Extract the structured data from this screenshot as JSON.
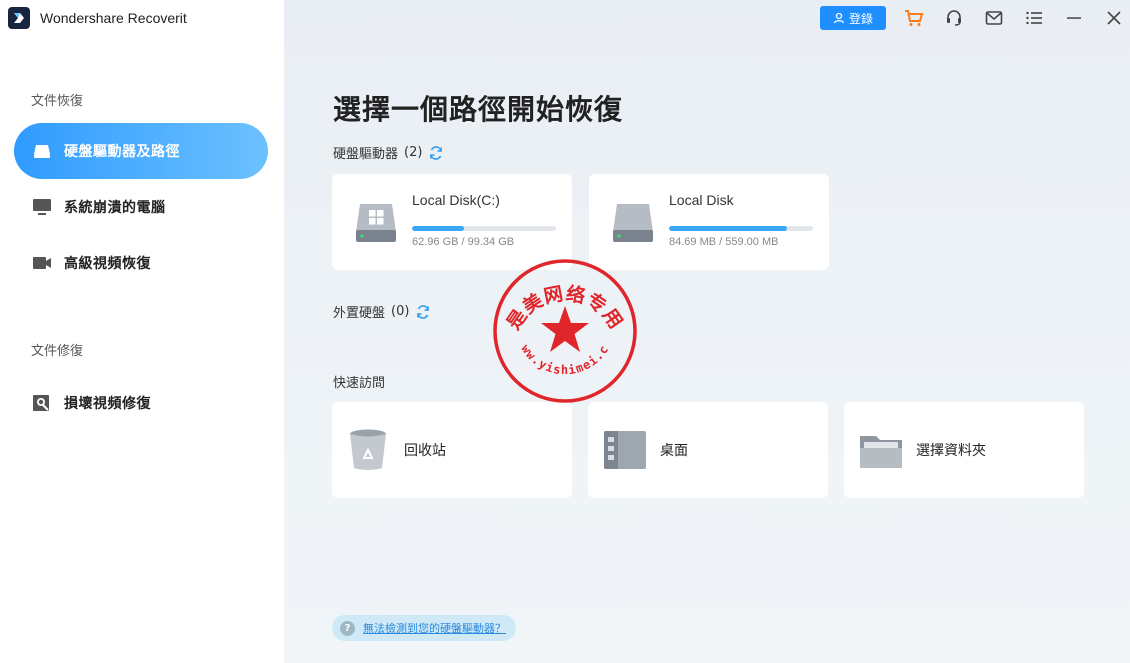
{
  "app": {
    "title": "Wondershare Recoverit"
  },
  "topbar": {
    "login_label": "登錄"
  },
  "sidebar": {
    "section_recover": "文件恢復",
    "items": [
      {
        "label": "硬盤驅動器及路徑",
        "icon": "hard-drive-icon",
        "active": true
      },
      {
        "label": "系統崩潰的電腦",
        "icon": "monitor-icon",
        "active": false
      },
      {
        "label": "高級視頻恢復",
        "icon": "video-camera-icon",
        "active": false
      }
    ],
    "section_repair": "文件修復",
    "repair_items": [
      {
        "label": "損壞視頻修復",
        "icon": "video-repair-icon"
      }
    ]
  },
  "main": {
    "title": "選擇一個路徑開始恢復",
    "drives_label": "硬盤驅動器",
    "drives_count": "(2)",
    "drives": [
      {
        "name": "Local Disk(C:)",
        "size": "62.96 GB / 99.34 GB",
        "usage": 0.36
      },
      {
        "name": "Local Disk",
        "size": "84.69 MB / 559.00 MB",
        "usage": 0.82
      }
    ],
    "external_label": "外置硬盤",
    "external_count": "(0)",
    "quick_label": "快速訪問",
    "quick_items": [
      {
        "label": "回收站"
      },
      {
        "label": "桌面"
      },
      {
        "label": "選擇資料夾"
      }
    ],
    "help_text": "無法檢測到您的硬盤驅動器？"
  },
  "stamp": {
    "arc_text": "赤是美网络专用章",
    "bottom_text": "www.yishimei.cn"
  },
  "colors": {
    "accent": "#1f8fff",
    "active_gradient_start": "#2f9bff",
    "active_gradient_end": "#6cc1ff",
    "stamp_red": "#e0262b"
  }
}
